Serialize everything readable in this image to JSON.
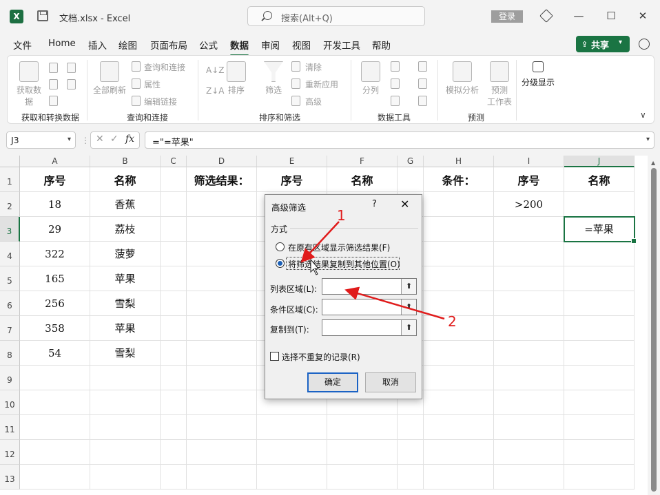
{
  "window": {
    "doc_title": "文档.xlsx  -  Excel",
    "search_placeholder": "搜索(Alt+Q)",
    "login": "登录",
    "minimize": "—",
    "maximize": "☐",
    "close": "✕"
  },
  "tabs": [
    "文件",
    "Home",
    "插入",
    "绘图",
    "页面布局",
    "公式",
    "数据",
    "审阅",
    "视图",
    "开发工具",
    "帮助"
  ],
  "active_tab": "数据",
  "share_label": "共享",
  "ribbon": {
    "get_data_label": "获取数",
    "get_data_label2": "据",
    "refresh_all": "全部刷新",
    "query_conn": "查询和连接",
    "properties": "属性",
    "edit_links": "编辑链接",
    "sort": "排序",
    "filter": "筛选",
    "clear": "清除",
    "reapply": "重新应用",
    "advanced": "高级",
    "split": "分列",
    "what_if": "模拟分析",
    "forecast_1": "预测",
    "forecast_2": "工作表",
    "outline": "分级显示",
    "groups": [
      "获取和转换数据",
      "查询和连接",
      "排序和筛选",
      "数据工具",
      "预测"
    ]
  },
  "formula_bar": {
    "name_box": "J3",
    "formula": "=\"=苹果\""
  },
  "grid": {
    "columns": [
      "A",
      "B",
      "C",
      "D",
      "E",
      "F",
      "G",
      "H",
      "I",
      "J"
    ],
    "rows": [
      "1",
      "2",
      "3",
      "4",
      "5",
      "6",
      "7",
      "8",
      "9",
      "10",
      "11",
      "12",
      "13"
    ],
    "headers": {
      "A1": "序号",
      "B1": "名称",
      "D1": "筛选结果：",
      "E1": "序号",
      "F1": "名称",
      "H1": "条件：",
      "I1": "序号",
      "J1": "名称"
    },
    "data": [
      {
        "seq": "18",
        "name": "香蕉"
      },
      {
        "seq": "29",
        "name": "荔枝"
      },
      {
        "seq": "322",
        "name": "菠萝"
      },
      {
        "seq": "165",
        "name": "苹果"
      },
      {
        "seq": "256",
        "name": "雪梨"
      },
      {
        "seq": "358",
        "name": "苹果"
      },
      {
        "seq": "54",
        "name": "雪梨"
      }
    ],
    "I2": ">200",
    "J3": "=苹果",
    "active_cell": "J3"
  },
  "dialog": {
    "title": "高级筛选",
    "help": "?",
    "close": "✕",
    "section": "方式",
    "option1": "在原有区域显示筛选结果(F)",
    "option2": "将筛选结果复制到其他位置(O)",
    "selected_option": "option2",
    "list_range_label": "列表区域(L):",
    "criteria_range_label": "条件区域(C):",
    "copy_to_label": "复制到(T):",
    "list_range_value": "",
    "criteria_range_value": "",
    "copy_to_value": "",
    "unique_label": "选择不重复的记录(R)",
    "unique_checked": false,
    "ok": "确定",
    "cancel": "取消"
  },
  "annotations": {
    "n1": "1",
    "n2": "2",
    "color": "#e01b1b"
  },
  "colors": {
    "accent": "#1a7443",
    "grid_line": "#e1e1e1"
  }
}
